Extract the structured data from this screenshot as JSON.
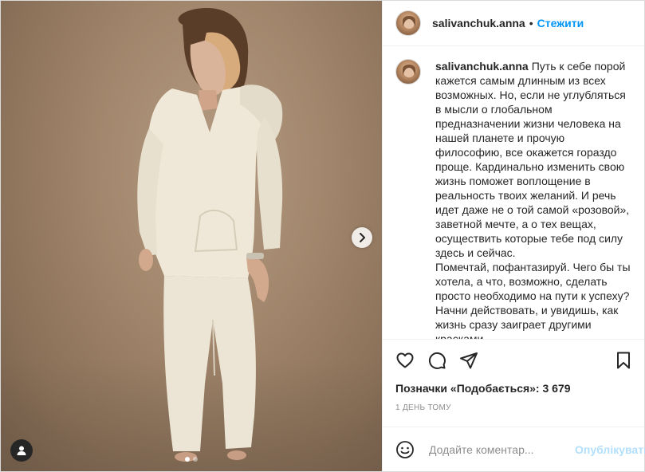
{
  "header": {
    "username": "salivanchuk.anna",
    "separator": "•",
    "follow_label": "Стежити"
  },
  "caption": {
    "username": "salivanchuk.anna",
    "paragraph1": "Путь к себе порой кажется самым длинным из всех возможных. Но, если не углубляться в мысли о глобальном предназначении жизни человека на нашей планете и прочую философию, все окажется гораздо проще. Кардинально изменить свою жизнь поможет воплощение в реальность твоих желаний. И речь идет даже не о той самой «розовой», заветной мечте, а о тех вещах, осуществить которые тебе под силу здесь и сейчас.",
    "paragraph2": "Помечтай, пофантазируй. Чего бы ты хотела, а что, возможно, сделать просто необходимо на пути к успеху? Начни действовать, и увидишь, как жизнь сразу заиграет другими красками"
  },
  "likes": {
    "label": "Позначки «Подобається»:",
    "count": "3 679"
  },
  "timestamp": "1 день тому",
  "comment": {
    "placeholder": "Додайте коментар...",
    "publish_label": "Опублікувати"
  },
  "carousel": {
    "total": 2,
    "active": 1
  },
  "icons": {
    "like": "heart-icon",
    "comment": "comment-bubble-icon",
    "share": "paper-plane-icon",
    "save": "bookmark-icon",
    "emoji": "smiley-icon",
    "next": "chevron-right-icon",
    "tags": "user-tag-icon"
  },
  "colors": {
    "accent": "#0095f6",
    "accent_disabled": "#b2dffc",
    "text": "#262626",
    "muted": "#8e8e8e",
    "border": "#dbdbdb"
  }
}
